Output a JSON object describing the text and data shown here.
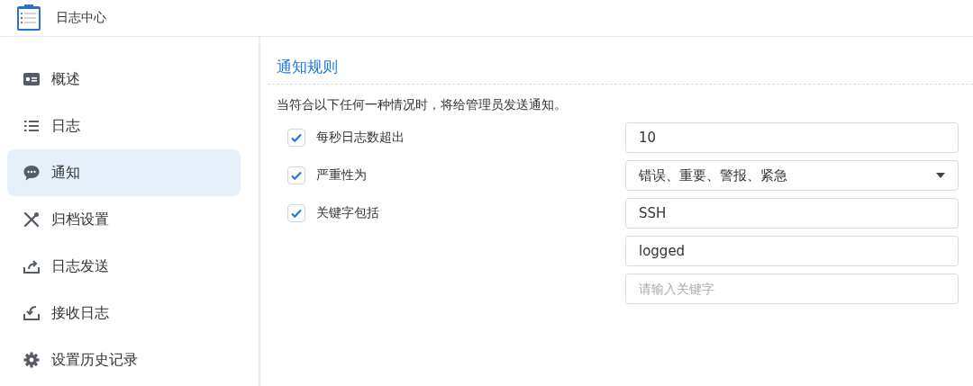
{
  "window": {
    "title": "日志中心"
  },
  "sidebar": {
    "items": [
      {
        "label": "概述",
        "selected": false
      },
      {
        "label": "日志",
        "selected": false
      },
      {
        "label": "通知",
        "selected": true
      },
      {
        "label": "归档设置",
        "selected": false
      },
      {
        "label": "日志发送",
        "selected": false
      },
      {
        "label": "接收日志",
        "selected": false
      },
      {
        "label": "设置历史记录",
        "selected": false
      }
    ]
  },
  "section": {
    "title": "通知规则",
    "description": "当符合以下任何一种情况时，将给管理员发送通知。",
    "rules": [
      {
        "label": "每秒日志数超出",
        "checked": true,
        "kind": "input",
        "fields": [
          {
            "value": "10"
          }
        ]
      },
      {
        "label": "严重性为",
        "checked": true,
        "kind": "select",
        "fields": [
          {
            "value": "错误、重要、警报、紧急"
          }
        ]
      },
      {
        "label": "关键字包括",
        "checked": true,
        "kind": "input",
        "fields": [
          {
            "value": "SSH"
          },
          {
            "value": "logged"
          },
          {
            "placeholder": "请输入关键字"
          }
        ]
      }
    ]
  }
}
